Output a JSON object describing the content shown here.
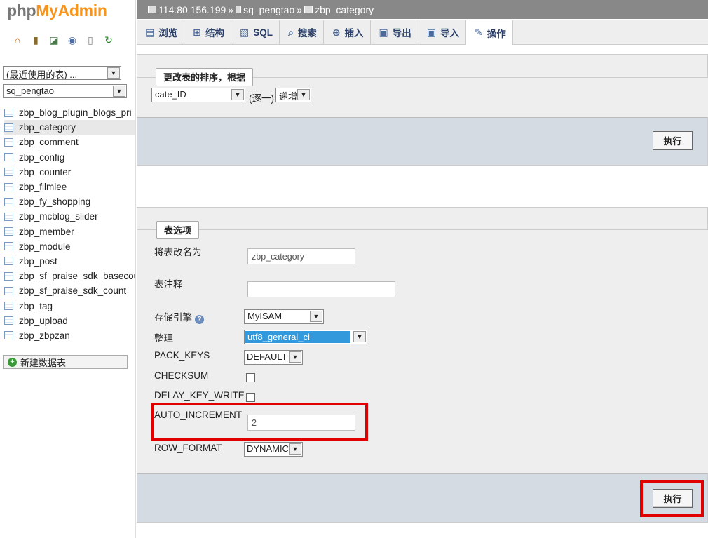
{
  "logo": {
    "php": "php",
    "myadmin": "MyAdmin"
  },
  "sidebar": {
    "quick_icons": [
      "home-icon",
      "exit-icon",
      "query-icon",
      "help-icon",
      "docs-icon",
      "reload-icon"
    ],
    "recent_select": "(最近使用的表) ...",
    "db_select": "sq_pengtao",
    "tables": [
      "zbp_blog_plugin_blogs_pri",
      "zbp_category",
      "zbp_comment",
      "zbp_config",
      "zbp_counter",
      "zbp_filmlee",
      "zbp_fy_shopping",
      "zbp_mcblog_slider",
      "zbp_member",
      "zbp_module",
      "zbp_post",
      "zbp_sf_praise_sdk_basecou",
      "zbp_sf_praise_sdk_count",
      "zbp_tag",
      "zbp_upload",
      "zbp_zbpzan"
    ],
    "active_table": "zbp_category",
    "new_table": "新建数据表"
  },
  "breadcrumb": {
    "server": "114.80.156.199",
    "sep": "»",
    "database": "sq_pengtao",
    "table": "zbp_category"
  },
  "tabs": [
    {
      "label": "浏览",
      "icon": "browse-icon",
      "glyph": "▤"
    },
    {
      "label": "结构",
      "icon": "structure-icon",
      "glyph": "⊞"
    },
    {
      "label": "SQL",
      "icon": "sql-icon",
      "glyph": "▧"
    },
    {
      "label": "搜索",
      "icon": "search-icon",
      "glyph": "⌕"
    },
    {
      "label": "插入",
      "icon": "insert-icon",
      "glyph": "⊕"
    },
    {
      "label": "导出",
      "icon": "export-icon",
      "glyph": "▣"
    },
    {
      "label": "导入",
      "icon": "import-icon",
      "glyph": "▣"
    },
    {
      "label": "操作",
      "icon": "wrench-icon",
      "glyph": "✎"
    }
  ],
  "sort_section": {
    "legend": "更改表的排序，根据",
    "column": "cate_ID",
    "singly": "(逐一)",
    "order": "递增",
    "go": "执行"
  },
  "options_section": {
    "legend": "表选项",
    "rename_label": "将表改名为",
    "rename_value": "zbp_category",
    "comment_label": "表注释",
    "comment_value": "",
    "engine_label": "存储引擎",
    "engine_value": "MyISAM",
    "collation_label": "整理",
    "collation_value": "utf8_general_ci",
    "pack_keys_label": "PACK_KEYS",
    "pack_keys_value": "DEFAULT",
    "checksum_label": "CHECKSUM",
    "delay_key_write_label": "DELAY_KEY_WRITE",
    "auto_increment_label": "AUTO_INCREMENT",
    "auto_increment_value": "2",
    "row_format_label": "ROW_FORMAT",
    "row_format_value": "DYNAMIC",
    "go": "执行"
  },
  "colors": {
    "highlight": "#e00000",
    "accent": "#f7941d",
    "selection": "#3399dd"
  }
}
